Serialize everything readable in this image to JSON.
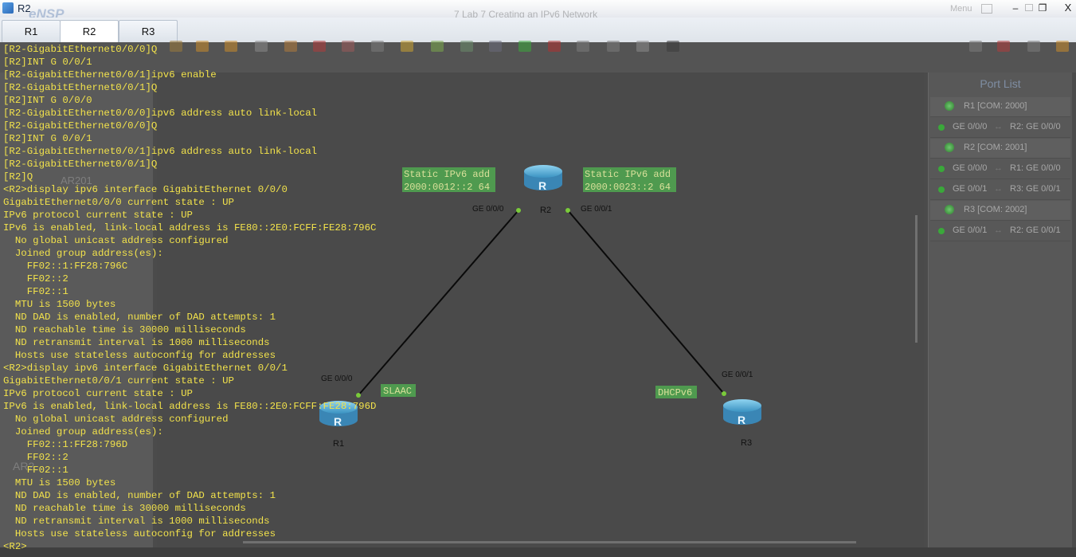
{
  "window": {
    "title": "R2",
    "ghost_logo": "eNSP",
    "ghost_project": "7 Lab 7 Creating an IPv6 Network",
    "ghost_menu": "Menu"
  },
  "tabs": [
    {
      "label": "R1"
    },
    {
      "label": "R2"
    },
    {
      "label": "R3"
    }
  ],
  "left_panel_ghost": {
    "device": "AR201",
    "section": "AR2"
  },
  "topology": {
    "routers": [
      {
        "name": "R2"
      },
      {
        "name": "R1"
      },
      {
        "name": "R3"
      }
    ],
    "interfaces": {
      "r2_left": "GE 0/0/0",
      "r2_right": "GE 0/0/1",
      "r1": "GE 0/0/0",
      "r3": "GE 0/0/1"
    },
    "notes": {
      "left_line1": "Static IPv6 add",
      "left_line2": "2000:0012::2 64",
      "right_line1": "Static IPv6 add",
      "right_line2": "2000:0023::2 64",
      "slaac": "SLAAC",
      "dhcp": "DHCPv6"
    }
  },
  "port_list": {
    "title": "Port List",
    "rows": [
      {
        "kind": "device",
        "left": "R1 [COM: 2000]"
      },
      {
        "kind": "link",
        "left": "GE 0/0/0",
        "right": "R2: GE 0/0/0"
      },
      {
        "kind": "device",
        "left": "R2 [COM: 2001]"
      },
      {
        "kind": "link",
        "left": "GE 0/0/0",
        "right": "R1: GE 0/0/0"
      },
      {
        "kind": "link",
        "left": "GE 0/0/1",
        "right": "R3: GE 0/0/1"
      },
      {
        "kind": "device",
        "left": "R3 [COM: 2002]"
      },
      {
        "kind": "link",
        "left": "GE 0/0/1",
        "right": "R2: GE 0/0/1"
      }
    ]
  },
  "console": {
    "lines": [
      "[R2-GigabitEthernet0/0/0]Q",
      "[R2]INT G 0/0/1",
      "[R2-GigabitEthernet0/0/1]ipv6 enable",
      "[R2-GigabitEthernet0/0/1]Q",
      "[R2]INT G 0/0/0",
      "[R2-GigabitEthernet0/0/0]ipv6 address auto link-local",
      "[R2-GigabitEthernet0/0/0]Q",
      "[R2]INT G 0/0/1",
      "[R2-GigabitEthernet0/0/1]ipv6 address auto link-local",
      "[R2-GigabitEthernet0/0/1]Q",
      "[R2]Q",
      "<R2>display ipv6 interface GigabitEthernet 0/0/0",
      "GigabitEthernet0/0/0 current state : UP",
      "IPv6 protocol current state : UP",
      "IPv6 is enabled, link-local address is FE80::2E0:FCFF:FE28:796C",
      "  No global unicast address configured",
      "  Joined group address(es):",
      "    FF02::1:FF28:796C",
      "    FF02::2",
      "    FF02::1",
      "  MTU is 1500 bytes",
      "  ND DAD is enabled, number of DAD attempts: 1",
      "  ND reachable time is 30000 milliseconds",
      "  ND retransmit interval is 1000 milliseconds",
      "  Hosts use stateless autoconfig for addresses",
      "<R2>display ipv6 interface GigabitEthernet 0/0/1",
      "GigabitEthernet0/0/1 current state : UP",
      "IPv6 protocol current state : UP",
      "IPv6 is enabled, link-local address is FE80::2E0:FCFF:FE28:796D",
      "  No global unicast address configured",
      "  Joined group address(es):",
      "    FF02::1:FF28:796D",
      "    FF02::2",
      "    FF02::1",
      "  MTU is 1500 bytes",
      "  ND DAD is enabled, number of DAD attempts: 1",
      "  ND reachable time is 30000 milliseconds",
      "  ND retransmit interval is 1000 milliseconds",
      "  Hosts use stateless autoconfig for addresses",
      "<R2>"
    ]
  },
  "colors": {
    "console_text": "#f2e24b",
    "router_body": "#5fb0d6",
    "note_bg": "#4f9a4f",
    "link_dot": "#3aa83a"
  }
}
